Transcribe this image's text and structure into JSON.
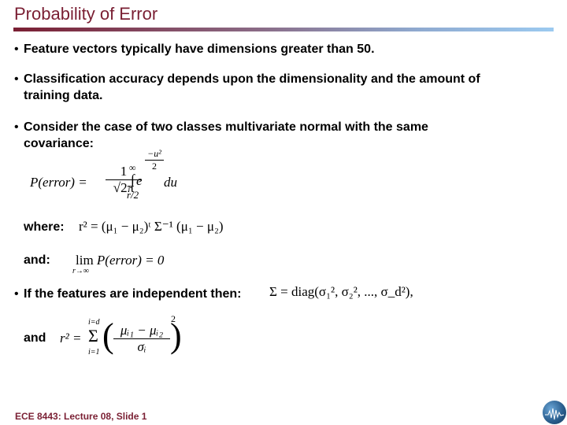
{
  "slide": {
    "title": "Probability of Error",
    "bullets": [
      {
        "text": "Feature vectors typically have dimensions greater than 50."
      },
      {
        "text": "Classification accuracy depends upon the dimensionality and the amount of"
      },
      {
        "text_cont": "training data."
      },
      {
        "text": "Consider the case of two classes multivariate normal with the same"
      },
      {
        "text_cont": "covariance:"
      }
    ],
    "bullet_marker": "•",
    "eq1": {
      "lhs": "P(error) =",
      "frac_num": "1",
      "frac_den": "√2π",
      "integral": "∫",
      "upper": "∞",
      "lower": "r/2",
      "base": "e",
      "exp_num": "−u²",
      "exp_den": "2",
      "tail": "du"
    },
    "where_label": "where:",
    "eq2": "r² = (μ₁ − μ₂)ᵗ Σ⁻¹ (μ₁ − μ₂)",
    "and_label": "and:",
    "eq3": {
      "lim": "lim",
      "sub": "r→∞",
      "rest": "P(error) = 0"
    },
    "independent_text": "If the features are independent then:",
    "eq4": "Σ = diag(σ₁², σ₂², ..., σ_d²),",
    "and2_label": "and",
    "eq5": {
      "lhs": "r² =",
      "sum": "Σ",
      "upper": "i=d",
      "lower": "i=1",
      "num": "μᵢ₁ − μᵢ₂",
      "den": "σᵢ",
      "power": "2"
    },
    "footer": "ECE 8443: Lecture 08, Slide 1",
    "logo_icon": "isip-globe-logo-icon",
    "colors": {
      "title": "#7a1f33",
      "footer": "#7a1f33",
      "rule_start": "#7a1f33",
      "rule_end": "#9ccaf0"
    }
  }
}
